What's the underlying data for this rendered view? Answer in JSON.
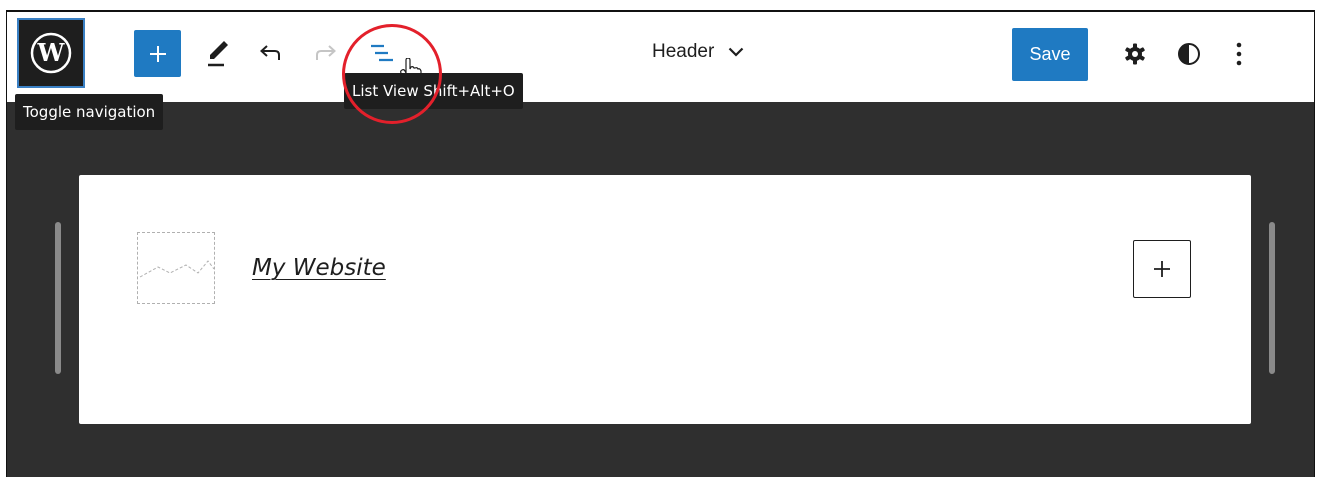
{
  "toolbar": {
    "logo_icon": "wordpress-icon",
    "toggle_navigation_tooltip": "Toggle navigation",
    "add_block_icon": "plus-icon",
    "tools_icon": "pencil-icon",
    "undo_icon": "undo-icon",
    "redo_icon": "redo-icon",
    "list_view_icon": "list-view-icon",
    "list_view_tooltip": "List View",
    "list_view_shortcut": "Shift+Alt+O",
    "template_part_title": "Header",
    "save_label": "Save",
    "settings_icon": "gear-icon",
    "styles_icon": "half-circle-icon",
    "options_icon": "vertical-dots-icon",
    "accent_color": "#1f7ac2"
  },
  "canvas": {
    "background_color": "#2f2f2f",
    "site_logo_icon": "site-logo-placeholder",
    "site_title": "My Website",
    "inserter_icon": "plus-icon"
  },
  "annotation": {
    "highlight_color": "#e3202b"
  }
}
